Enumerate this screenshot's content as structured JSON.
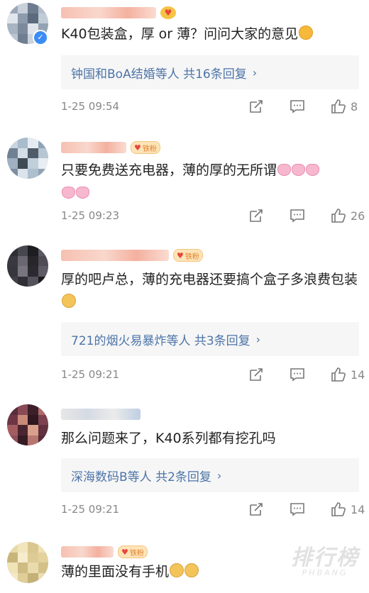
{
  "comments": [
    {
      "text": "K40包装盒，厚 or 薄？问问大家的意见",
      "emoji": "shocked-face-emoji",
      "reply": "钟国和BoA结婚等人  共16条回复",
      "time": "1-25 09:54",
      "likes": "8",
      "avatar_colors": [
        "#9aa8b8",
        "#c8d0da",
        "#6d7c8f",
        "#b4bfcc",
        "#e1e6ec",
        "#8d9bac",
        "#5b6a7c",
        "#c2ccd7",
        "#a7b4c2",
        "#7c8a9c",
        "#dfe4ea",
        "#94a3b3",
        "#bcc6d1",
        "#6f7e90",
        "#cad2db",
        "#8897a9"
      ]
    },
    {
      "text": "只要免费送充电器，薄的厚的无所谓",
      "badge": "铁粉",
      "time": "1-25 09:23",
      "likes": "26",
      "avatar_colors": [
        "#c8d4df",
        "#a9bccb",
        "#e5ecf1",
        "#8fa3b5",
        "#6f8192",
        "#d2dde6",
        "#4e5b68",
        "#b7c6d3",
        "#9fb1c1",
        "#3f4a55",
        "#c1cfdb",
        "#e8eef3",
        "#7d8ea0",
        "#dbe4eb",
        "#aebfcd",
        "#91a4b6"
      ]
    },
    {
      "text": "厚的吧卢总，薄的充电器还要搞个盒子多浪费包装",
      "badge": "铁粉",
      "reply": "721的烟火易暴炸等人  共3条回复",
      "time": "1-25 09:21",
      "likes": "14",
      "avatar_colors": [
        "#2e2e33",
        "#474750",
        "#1e1e22",
        "#5a5863",
        "#3a3940",
        "#6b6772",
        "#27262b",
        "#4f4c56",
        "#38363d",
        "#7a7481",
        "#2b2a30",
        "#5f5b66",
        "#413f47",
        "#302f35",
        "#55525c",
        "#1c1b1f"
      ]
    },
    {
      "text": "那么问题来了，K40系列都有挖孔吗",
      "reply": "深海数码B等人  共2条回复",
      "time": "1-25 09:21",
      "likes": "14",
      "avatar_colors": [
        "#5a2c3a",
        "#8a4a55",
        "#3d1f2a",
        "#b06a6a",
        "#6d3545",
        "#c98a7a",
        "#2f1820",
        "#7c4250",
        "#a35d60",
        "#4a2530",
        "#d9a08c",
        "#63303f",
        "#8f5059",
        "#351b24",
        "#b87670",
        "#572a37"
      ]
    },
    {
      "text": "薄的里面没有手机",
      "badge": "铁粉",
      "avatar_colors": [
        "#e8d9a8",
        "#f2e6bd",
        "#d9c78f",
        "#efe1b3",
        "#c9b57a",
        "#f6edcc",
        "#dccb95",
        "#e3d29e",
        "#f0e4b9",
        "#cfbc83",
        "#e9dbab",
        "#d4c189",
        "#f4e9c4",
        "#dfce99",
        "#c5b077",
        "#ebdeb0"
      ]
    }
  ],
  "watermark": {
    "big": "排行榜",
    "small": "PHBANG"
  }
}
